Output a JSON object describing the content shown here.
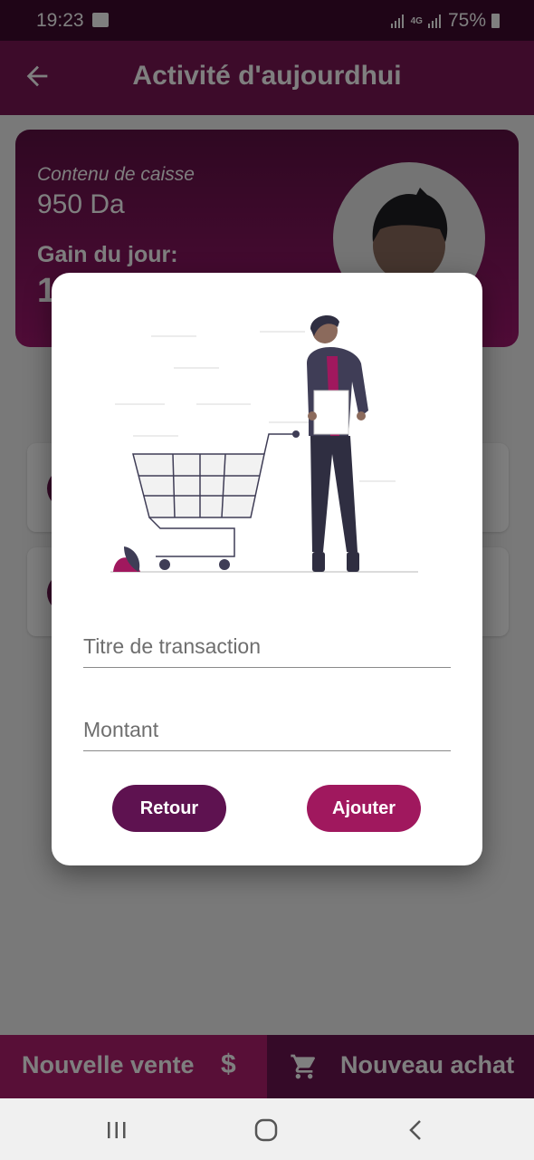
{
  "status": {
    "time": "19:23",
    "network": "4G",
    "battery": "75%"
  },
  "appbar": {
    "title": "Activité d'aujourdhui",
    "back_icon": "arrow-left-icon"
  },
  "summary": {
    "cash_label": "Contenu de caisse",
    "cash_value": "950 Da",
    "gain_label": "Gain du jour:",
    "gain_value": "1"
  },
  "dialog": {
    "title_placeholder": "Titre de transaction",
    "amount_placeholder": "Montant",
    "cancel_label": "Retour",
    "add_label": "Ajouter"
  },
  "bottom": {
    "sale_label": "Nouvelle vente",
    "sale_icon_text": "$",
    "purchase_label": "Nouveau achat",
    "purchase_icon": "cart-icon"
  },
  "navigation": {
    "recents_icon": "recents-icon",
    "home_icon": "home-icon",
    "back_icon": "back-chevron-icon"
  },
  "colors": {
    "primary": "#7a1654",
    "accent": "#a0185e",
    "dark": "#5e1250"
  }
}
